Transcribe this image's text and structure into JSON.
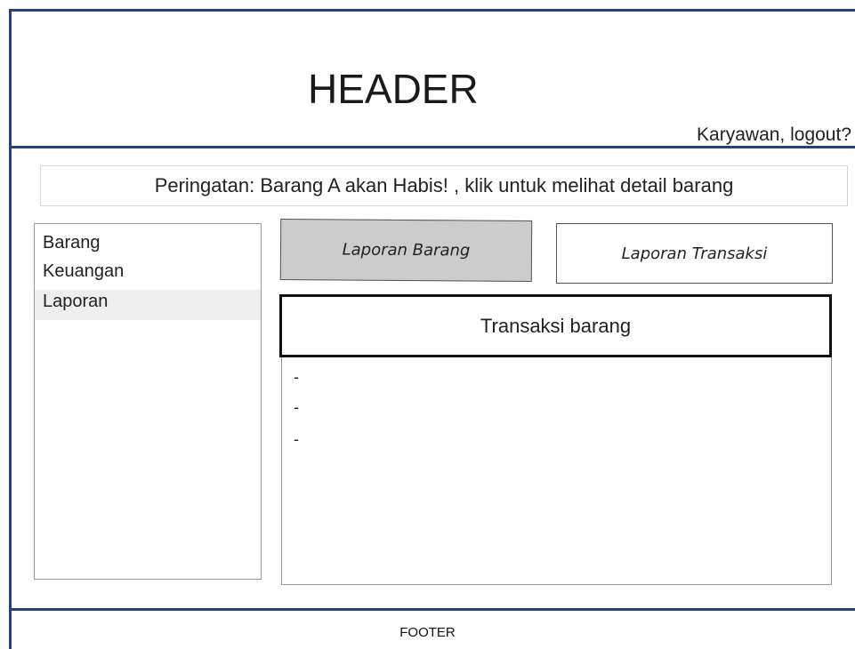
{
  "header": {
    "title": "HEADER",
    "user_link": "Karyawan, logout?"
  },
  "alert": {
    "text": "Peringatan: Barang A akan Habis! , klik untuk melihat detail barang"
  },
  "sidebar": {
    "items": [
      {
        "label": "Barang",
        "active": false
      },
      {
        "label": "Keuangan",
        "active": false
      },
      {
        "label": "Laporan",
        "active": true
      }
    ]
  },
  "buttons": {
    "laporan_barang": "Laporan Barang",
    "laporan_transaksi": "Laporan Transaksi"
  },
  "panel": {
    "title": "Transaksi barang",
    "items": [
      "-",
      "-",
      "-"
    ]
  },
  "footer": {
    "label": "FOOTER"
  },
  "colors": {
    "frame": "#2b3f7a",
    "active_button": "#cccccc",
    "active_sidebar": "#eeeeee"
  }
}
